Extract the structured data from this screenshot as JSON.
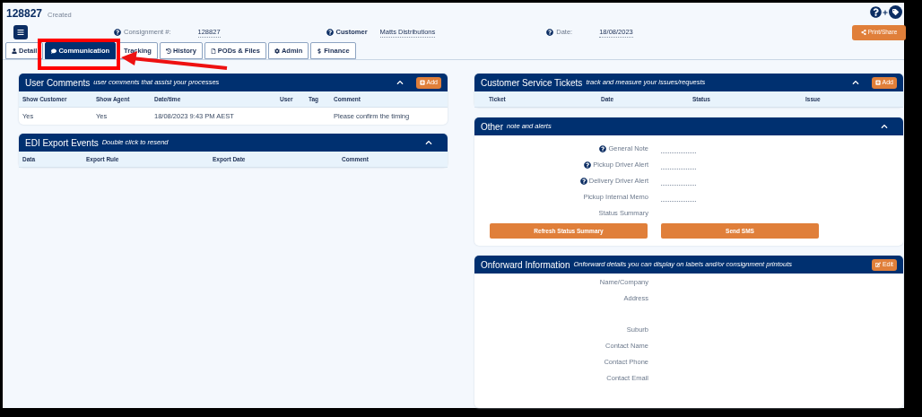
{
  "header": {
    "title": "128827",
    "status": "Created"
  },
  "fields": [
    {
      "label": "Consignment #:",
      "value": "128827",
      "help": true
    },
    {
      "label": "Customer",
      "value": "Matts Distributions",
      "help": true
    },
    {
      "label": "Date:",
      "value": "18/08/2023",
      "help": true
    }
  ],
  "print_button": "Print/Share",
  "tabs": [
    {
      "label": "Detail",
      "selected": false
    },
    {
      "label": "Communication",
      "selected": true
    },
    {
      "label": "Tracking",
      "selected": false
    },
    {
      "label": "History",
      "selected": false
    },
    {
      "label": "PODs & Files",
      "selected": false
    },
    {
      "label": "Admin",
      "selected": false
    },
    {
      "label": "Finance",
      "selected": false
    }
  ],
  "user_comments": {
    "title": "User Comments",
    "subtitle": "user comments that assist your processes",
    "action": "Add",
    "columns": [
      "Show Customer",
      "Show Agent",
      "Date/time",
      "User",
      "Tag",
      "Comment"
    ],
    "rows": [
      [
        "Yes",
        "Yes",
        "18/08/2023 9:43 PM AEST",
        "",
        "",
        "Please confirm the timing"
      ]
    ]
  },
  "edi": {
    "title": "EDI Export Events",
    "subtitle": "Double click to resend",
    "columns": [
      "Data",
      "Export Rule",
      "Export Date",
      "Comment"
    ]
  },
  "tickets": {
    "title": "Customer Service Tickets",
    "subtitle": "track and measure your issues/requests",
    "action": "Add",
    "columns": [
      "Ticket",
      "Date",
      "Status",
      "Issue"
    ]
  },
  "other": {
    "title": "Other",
    "subtitle": "note and alerts",
    "rows": [
      {
        "label": "General Note",
        "help": true,
        "editable": true
      },
      {
        "label": "Pickup Driver Alert",
        "help": true,
        "editable": true
      },
      {
        "label": "Delivery Driver Alert",
        "help": true,
        "editable": true
      },
      {
        "label": "Pickup Internal Memo",
        "help": false,
        "editable": true
      },
      {
        "label": "Status Summary",
        "help": false,
        "editable": false
      }
    ],
    "buttons": [
      "Refresh Status Summary",
      "Send SMS"
    ]
  },
  "onforward": {
    "title": "Onforward Information",
    "subtitle": "Onforward details you can display on labels and/or consignment printouts",
    "action": "Edit",
    "rows": [
      {
        "label": "Name/Company",
        "tall": false
      },
      {
        "label": "Address",
        "tall": true
      },
      {
        "label": "Suburb",
        "tall": false
      },
      {
        "label": "Contact Name",
        "tall": false
      },
      {
        "label": "Contact Phone",
        "tall": false
      },
      {
        "label": "Contact Email",
        "tall": false
      }
    ]
  }
}
